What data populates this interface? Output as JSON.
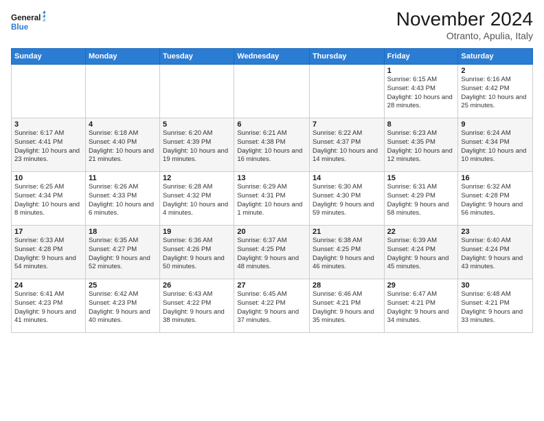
{
  "logo": {
    "line1": "General",
    "line2": "Blue"
  },
  "title": "November 2024",
  "location": "Otranto, Apulia, Italy",
  "days_of_week": [
    "Sunday",
    "Monday",
    "Tuesday",
    "Wednesday",
    "Thursday",
    "Friday",
    "Saturday"
  ],
  "weeks": [
    [
      {
        "day": "",
        "info": ""
      },
      {
        "day": "",
        "info": ""
      },
      {
        "day": "",
        "info": ""
      },
      {
        "day": "",
        "info": ""
      },
      {
        "day": "",
        "info": ""
      },
      {
        "day": "1",
        "info": "Sunrise: 6:15 AM\nSunset: 4:43 PM\nDaylight: 10 hours and 28 minutes."
      },
      {
        "day": "2",
        "info": "Sunrise: 6:16 AM\nSunset: 4:42 PM\nDaylight: 10 hours and 25 minutes."
      }
    ],
    [
      {
        "day": "3",
        "info": "Sunrise: 6:17 AM\nSunset: 4:41 PM\nDaylight: 10 hours and 23 minutes."
      },
      {
        "day": "4",
        "info": "Sunrise: 6:18 AM\nSunset: 4:40 PM\nDaylight: 10 hours and 21 minutes."
      },
      {
        "day": "5",
        "info": "Sunrise: 6:20 AM\nSunset: 4:39 PM\nDaylight: 10 hours and 19 minutes."
      },
      {
        "day": "6",
        "info": "Sunrise: 6:21 AM\nSunset: 4:38 PM\nDaylight: 10 hours and 16 minutes."
      },
      {
        "day": "7",
        "info": "Sunrise: 6:22 AM\nSunset: 4:37 PM\nDaylight: 10 hours and 14 minutes."
      },
      {
        "day": "8",
        "info": "Sunrise: 6:23 AM\nSunset: 4:35 PM\nDaylight: 10 hours and 12 minutes."
      },
      {
        "day": "9",
        "info": "Sunrise: 6:24 AM\nSunset: 4:34 PM\nDaylight: 10 hours and 10 minutes."
      }
    ],
    [
      {
        "day": "10",
        "info": "Sunrise: 6:25 AM\nSunset: 4:34 PM\nDaylight: 10 hours and 8 minutes."
      },
      {
        "day": "11",
        "info": "Sunrise: 6:26 AM\nSunset: 4:33 PM\nDaylight: 10 hours and 6 minutes."
      },
      {
        "day": "12",
        "info": "Sunrise: 6:28 AM\nSunset: 4:32 PM\nDaylight: 10 hours and 4 minutes."
      },
      {
        "day": "13",
        "info": "Sunrise: 6:29 AM\nSunset: 4:31 PM\nDaylight: 10 hours and 1 minute."
      },
      {
        "day": "14",
        "info": "Sunrise: 6:30 AM\nSunset: 4:30 PM\nDaylight: 9 hours and 59 minutes."
      },
      {
        "day": "15",
        "info": "Sunrise: 6:31 AM\nSunset: 4:29 PM\nDaylight: 9 hours and 58 minutes."
      },
      {
        "day": "16",
        "info": "Sunrise: 6:32 AM\nSunset: 4:28 PM\nDaylight: 9 hours and 56 minutes."
      }
    ],
    [
      {
        "day": "17",
        "info": "Sunrise: 6:33 AM\nSunset: 4:28 PM\nDaylight: 9 hours and 54 minutes."
      },
      {
        "day": "18",
        "info": "Sunrise: 6:35 AM\nSunset: 4:27 PM\nDaylight: 9 hours and 52 minutes."
      },
      {
        "day": "19",
        "info": "Sunrise: 6:36 AM\nSunset: 4:26 PM\nDaylight: 9 hours and 50 minutes."
      },
      {
        "day": "20",
        "info": "Sunrise: 6:37 AM\nSunset: 4:25 PM\nDaylight: 9 hours and 48 minutes."
      },
      {
        "day": "21",
        "info": "Sunrise: 6:38 AM\nSunset: 4:25 PM\nDaylight: 9 hours and 46 minutes."
      },
      {
        "day": "22",
        "info": "Sunrise: 6:39 AM\nSunset: 4:24 PM\nDaylight: 9 hours and 45 minutes."
      },
      {
        "day": "23",
        "info": "Sunrise: 6:40 AM\nSunset: 4:24 PM\nDaylight: 9 hours and 43 minutes."
      }
    ],
    [
      {
        "day": "24",
        "info": "Sunrise: 6:41 AM\nSunset: 4:23 PM\nDaylight: 9 hours and 41 minutes."
      },
      {
        "day": "25",
        "info": "Sunrise: 6:42 AM\nSunset: 4:23 PM\nDaylight: 9 hours and 40 minutes."
      },
      {
        "day": "26",
        "info": "Sunrise: 6:43 AM\nSunset: 4:22 PM\nDaylight: 9 hours and 38 minutes."
      },
      {
        "day": "27",
        "info": "Sunrise: 6:45 AM\nSunset: 4:22 PM\nDaylight: 9 hours and 37 minutes."
      },
      {
        "day": "28",
        "info": "Sunrise: 6:46 AM\nSunset: 4:21 PM\nDaylight: 9 hours and 35 minutes."
      },
      {
        "day": "29",
        "info": "Sunrise: 6:47 AM\nSunset: 4:21 PM\nDaylight: 9 hours and 34 minutes."
      },
      {
        "day": "30",
        "info": "Sunrise: 6:48 AM\nSunset: 4:21 PM\nDaylight: 9 hours and 33 minutes."
      }
    ]
  ]
}
